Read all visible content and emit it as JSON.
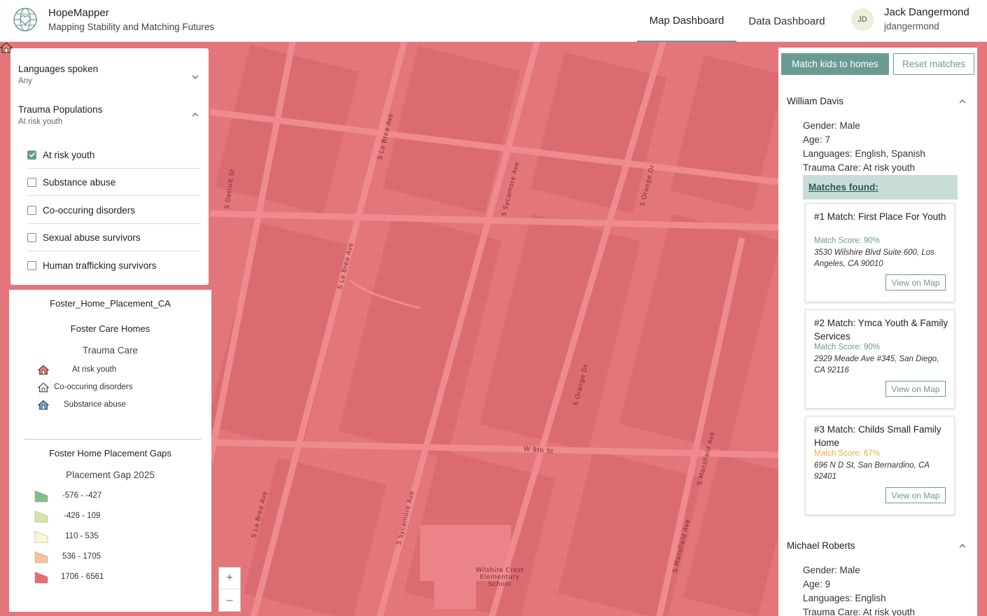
{
  "header": {
    "app_title": "HopeMapper",
    "app_subtitle": "Mapping Stability and Matching Futures",
    "tabs": [
      {
        "label": "Map Dashboard",
        "active": true
      },
      {
        "label": "Data Dashboard",
        "active": false
      }
    ],
    "user": {
      "initials": "JD",
      "name": "Jack Dangermond",
      "handle": "jdangermond"
    },
    "accent_color": "#6a9b93"
  },
  "filters": {
    "languages": {
      "title": "Languages spoken",
      "value": "Any"
    },
    "trauma": {
      "title": "Trauma Populations",
      "value": "At risk youth",
      "options": [
        {
          "label": "At risk youth",
          "checked": true
        },
        {
          "label": "Substance abuse",
          "checked": false
        },
        {
          "label": "Co-occuring disorders",
          "checked": false
        },
        {
          "label": "Sexual abuse survivors",
          "checked": false
        },
        {
          "label": "Human trafficking survivors",
          "checked": false
        }
      ]
    }
  },
  "legend": {
    "layer_title": "Foster_Home_Placement_CA",
    "homes_title": "Foster Care Homes",
    "homes_field": "Trauma Care",
    "homes_items": [
      {
        "label": "At risk youth",
        "color": "#e8826c"
      },
      {
        "label": "Co-occuring disorders",
        "color": "#f2f2f2"
      },
      {
        "label": "Substance abuse",
        "color": "#6fa8dc"
      }
    ],
    "gaps_title": "Foster Home Placement Gaps",
    "gaps_field": "Placement Gap 2025",
    "gaps_items": [
      {
        "label": "-576 - -427",
        "color": "#7fbf8c"
      },
      {
        "label": "-426 - 109",
        "color": "#d3e8a8"
      },
      {
        "label": "110 - 535",
        "color": "#fbf7d2"
      },
      {
        "label": "536 - 1705",
        "color": "#f8c29a"
      },
      {
        "label": "1706 - 6561",
        "color": "#e66b73"
      }
    ]
  },
  "map": {
    "fill_color": "#e3767a",
    "street_labels": [
      "S Detroit St",
      "S La Brea Ave",
      "S La Brea Ave",
      "S Sycamore Ave",
      "S Orange Dr",
      "S Orange Dr",
      "W 9th St",
      "S Mansfield Ave",
      "S La Brea Ave",
      "S Sycamore Ave",
      "S Mansfield Ave"
    ],
    "poi_label": "Wilshire Crest Elementary School",
    "zoom_in": "+",
    "zoom_out": "–"
  },
  "actions": {
    "match_label": "Match kids to homes",
    "reset_label": "Reset matches"
  },
  "kids": [
    {
      "name": "William Davis",
      "gender": "Gender: Male",
      "age": "Age: 7",
      "languages": "Languages: English, Spanish",
      "trauma": "Trauma Care: At risk youth",
      "matches_label": "Matches found:",
      "matches": [
        {
          "title": "#1 Match: First Place For Youth",
          "score": "Match Score: 90%",
          "score_color": "#6a9b93",
          "address": "3530 Wilshire Blvd Suite 600, Los Angeles, CA 90010",
          "button": "View on Map"
        },
        {
          "title": "#2 Match: Ymca Youth & Family Services",
          "score": "Match Score: 90%",
          "score_color": "#6a9b93",
          "address": "2929 Meade Ave #345, San Diego, CA 92116",
          "button": "View on Map"
        },
        {
          "title": "#3 Match: Childs Small Family Home",
          "score": "Match Score: 67%",
          "score_color": "#e8b043",
          "address": "696 N D St, San Bernardino, CA 92401",
          "button": "View on Map"
        }
      ]
    },
    {
      "name": "Michael Roberts",
      "gender": "Gender: Male",
      "age": "Age: 9",
      "languages": "Languages: English",
      "trauma": "Trauma Care: At risk youth"
    }
  ]
}
